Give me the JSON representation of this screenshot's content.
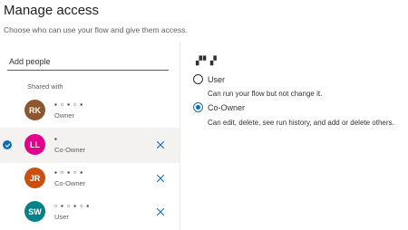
{
  "header": {
    "title": "Manage access",
    "subtitle": "Choose who can use your flow and give them access."
  },
  "people": {
    "placeholder": "Add people",
    "shared_with_label": "Shared with",
    "list": [
      {
        "initials": "RK",
        "name": "▪  ▫ ▪ ▫ ▪",
        "role": "Owner",
        "color": "#8e562e",
        "selected": false,
        "removable": false
      },
      {
        "initials": "LL",
        "name": "▪",
        "role": "Co-Owner",
        "color": "#e3008c",
        "selected": true,
        "removable": true
      },
      {
        "initials": "JR",
        "name": "▪ ▫ ▪ ▫ ▪",
        "role": "Co-Owner",
        "color": "#ca5010",
        "selected": false,
        "removable": true
      },
      {
        "initials": "SW",
        "name": "▫ ▪ ▫ ▪ ▫ ▪",
        "role": "User",
        "color": "#038387",
        "selected": false,
        "removable": true
      }
    ]
  },
  "permissions": {
    "selected_name": "▞▘▞",
    "options": [
      {
        "label": "User",
        "description": "Can run your flow but not change it.",
        "checked": false
      },
      {
        "label": "Co-Owner",
        "description": "Can edit, delete, see run history, and add or delete others.",
        "checked": true
      }
    ]
  },
  "colors": {
    "accent": "#0f6cbd",
    "selected_row_bg": "#f3f2f1"
  }
}
